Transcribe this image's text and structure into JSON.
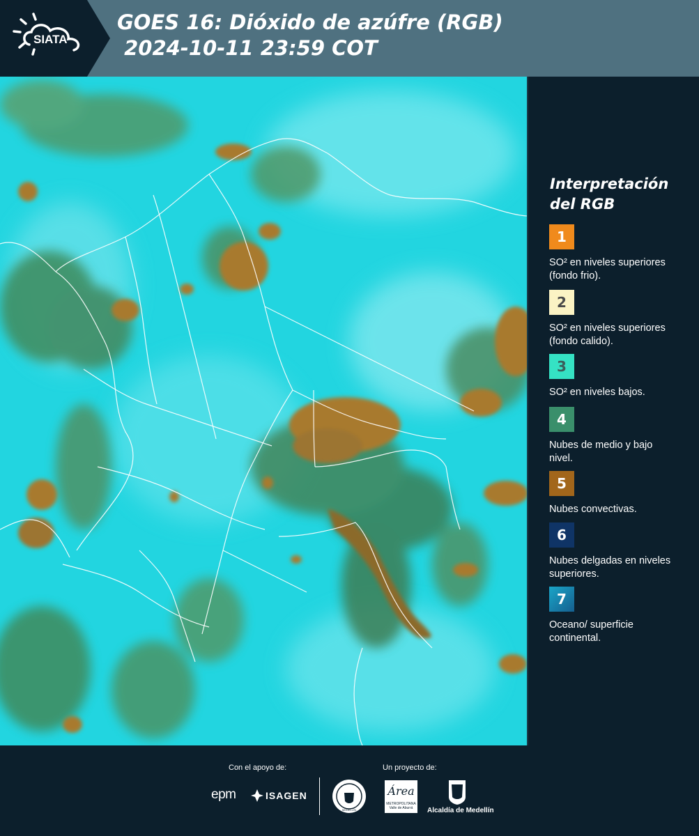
{
  "header": {
    "logo_text": "SIATA",
    "title_line1": "GOES 16: Dióxido de azúfre (RGB)",
    "title_line2": " 2024-10-11 23:59 COT"
  },
  "legend": {
    "title": "Interpretación del RGB",
    "items": [
      {
        "num": "1",
        "color": "#f08a1c",
        "text": "SO² en niveles superiores (fondo frio)."
      },
      {
        "num": "2",
        "color": "#fbf3c4",
        "text": "SO² en niveles superiores (fondo calido)."
      },
      {
        "num": "3",
        "color": "#35e2c4",
        "text": "SO² en niveles bajos."
      },
      {
        "num": "4",
        "color": "#3a8f6b",
        "text": "Nubes de medio y bajo nivel."
      },
      {
        "num": "5",
        "color": "#a2661b",
        "text": "Nubes convectivas."
      },
      {
        "num": "6",
        "color": "#0f3466",
        "text": "Nubes delgadas en niveles superiores."
      },
      {
        "num": "7",
        "color": "#1e8ab8",
        "text": "Oceano/ superficie continental."
      }
    ]
  },
  "footer": {
    "support_label": "Con el apoyo de:",
    "project_label": "Un proyecto de:",
    "logo_epm": "epm",
    "logo_isagen": "ISAGEN",
    "logo_medellin": "MEDELLÍN",
    "logo_area": "Área",
    "logo_area_sub1": "METROPOLITANA",
    "logo_area_sub2": "Valle de Aburrá",
    "logo_alcaldia": "Alcaldía de Medellín"
  },
  "colors": {
    "header_bg": "#4f7180",
    "panel_bg": "#0c1f2c",
    "map_bg": "#1fd6e0",
    "cloud_brown": "#a87a2e",
    "cloud_green": "#4e8a5a"
  }
}
